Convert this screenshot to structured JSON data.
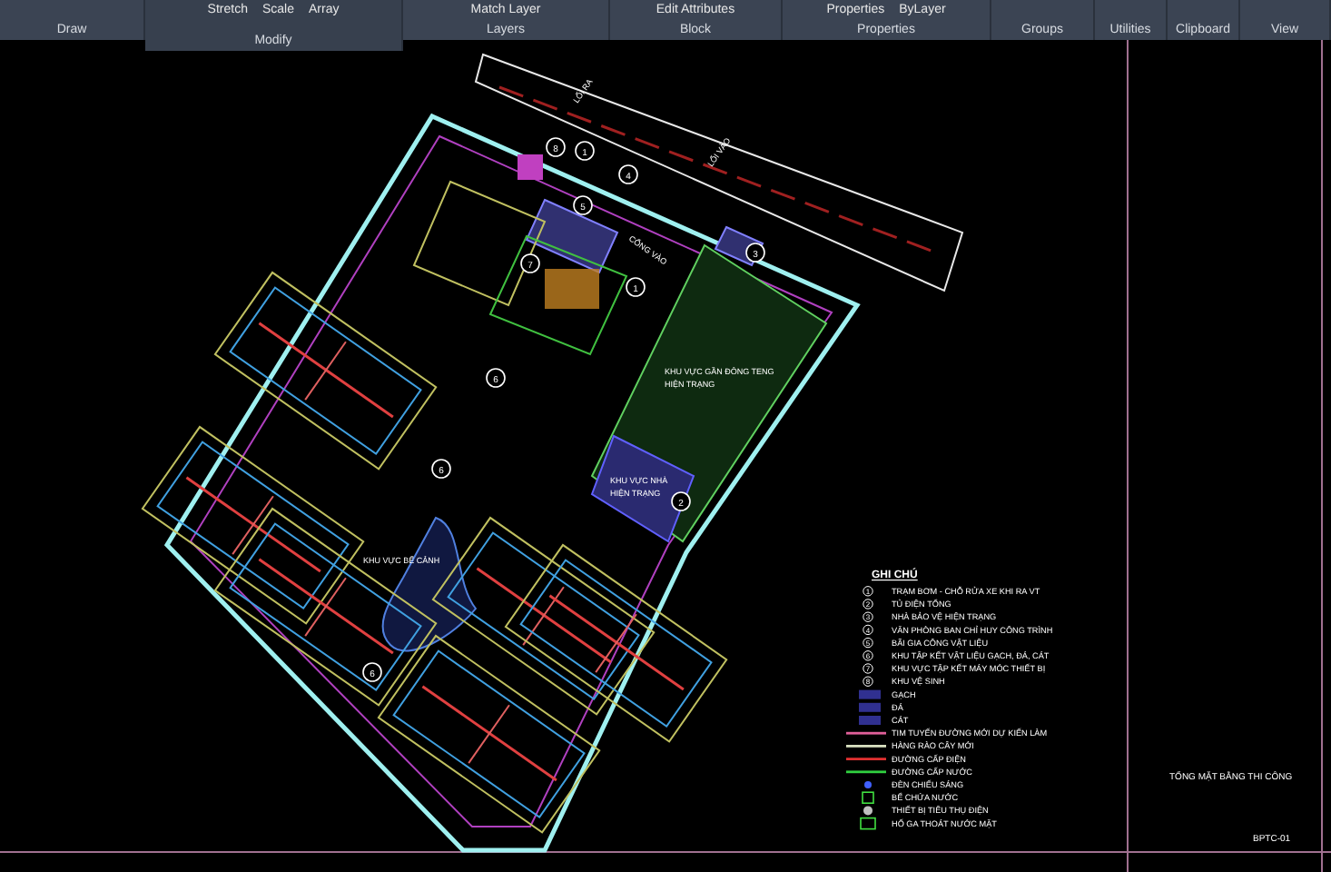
{
  "ribbon": {
    "panels": [
      {
        "label": "Draw"
      },
      {
        "label": "Modify",
        "tools": [
          "Stretch",
          "Scale",
          "Array"
        ],
        "expanded": true
      },
      {
        "label": "Layers",
        "tools": [
          "Match Layer"
        ]
      },
      {
        "label": "Block",
        "tools": [
          "Edit Attributes"
        ]
      },
      {
        "label": "Properties",
        "tools": [
          "Properties",
          "ByLayer"
        ]
      },
      {
        "label": "Groups"
      },
      {
        "label": "Utilities"
      },
      {
        "label": "Clipboard"
      },
      {
        "label": "View"
      }
    ]
  },
  "drawing": {
    "markers": [
      "8",
      "1",
      "4",
      "5",
      "1",
      "7",
      "3",
      "6",
      "6",
      "2",
      "6"
    ],
    "labels": [
      "LỐI RA",
      "LỐI VÀO",
      "CỔNG VÀO",
      "KHU VỰC GẦN ĐÔNG TENG",
      "HIỆN TRẠNG",
      "KHU VỰC NHÀ",
      "HIỆN TRẠNG",
      "KHU VỰC BỂ CẢNH"
    ]
  },
  "legend": {
    "title": "GHI CHÚ",
    "items": [
      {
        "kind": "numbered",
        "number": "1",
        "text": "TRẠM BƠM - CHỖ RỬA XE KHI RA VT"
      },
      {
        "kind": "numbered",
        "number": "2",
        "text": "TỦ ĐIỆN TỔNG"
      },
      {
        "kind": "numbered",
        "number": "3",
        "text": "NHÀ BẢO VỆ HIỆN TRẠNG"
      },
      {
        "kind": "numbered",
        "number": "4",
        "text": "VĂN PHÒNG BAN CHỈ HUY CÔNG TRÌNH"
      },
      {
        "kind": "numbered",
        "number": "5",
        "text": "BÃI GIA CÔNG VẬT LIỆU"
      },
      {
        "kind": "numbered",
        "number": "6",
        "text": "KHU TẬP KẾT VẬT LIỆU GẠCH, ĐÁ, CÁT"
      },
      {
        "kind": "numbered",
        "number": "7",
        "text": "KHU VỰC TẬP KẾT MÁY MÓC THIẾT BỊ"
      },
      {
        "kind": "numbered",
        "number": "8",
        "text": "KHU VỆ SINH"
      },
      {
        "kind": "swatch",
        "text": "GẠCH"
      },
      {
        "kind": "swatch",
        "text": "ĐÁ"
      },
      {
        "kind": "swatch",
        "text": "CÁT"
      },
      {
        "kind": "line",
        "color": "#e0609a",
        "text": "TIM TUYẾN ĐƯỜNG MỚI DỰ KIẾN LÀM"
      },
      {
        "kind": "line",
        "color": "#d8e0c0",
        "text": "HÀNG RÀO CÂY MỚI"
      },
      {
        "kind": "line",
        "color": "#e03030",
        "text": "ĐƯỜNG CẤP ĐIỆN"
      },
      {
        "kind": "line",
        "color": "#30d040",
        "text": "ĐƯỜNG CẤP NƯỚC"
      },
      {
        "kind": "lamp",
        "text": "ĐÈN CHIẾU SÁNG"
      },
      {
        "kind": "tank",
        "text": "BỂ CHỨA NƯỚC"
      },
      {
        "kind": "device",
        "text": "THIẾT BỊ TIÊU THỤ ĐIỆN"
      },
      {
        "kind": "pit",
        "text": "HỐ GA THOÁT NƯỚC MẶT"
      }
    ]
  },
  "title_block": {
    "title": "TỔNG MẶT BẰNG THI CÔNG",
    "code": "BPTC-01"
  }
}
